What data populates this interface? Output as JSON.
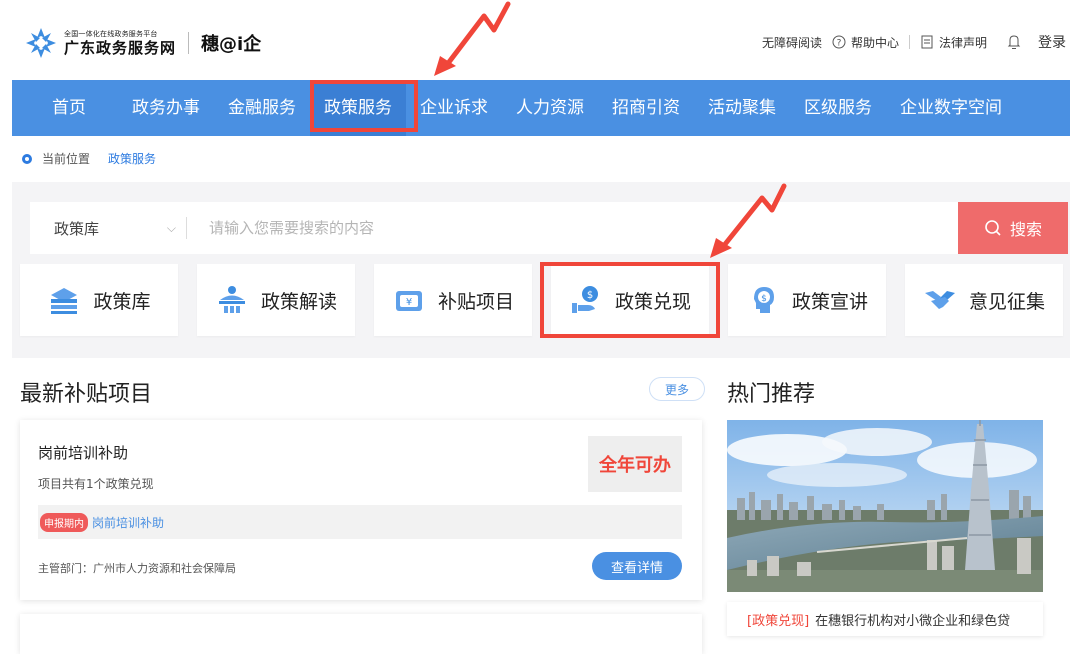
{
  "header": {
    "logo_sub": "全国一体化在线政务服务平台",
    "logo_main": "广东政务服务网",
    "brand": "穗@i企",
    "links": {
      "accessibility": "无障碍阅读",
      "help": "帮助中心",
      "legal": "法律声明",
      "login": "登录"
    },
    "icons": [
      "logo-icon",
      "help-icon",
      "document-icon",
      "bell-icon"
    ]
  },
  "nav": {
    "items": [
      "首页",
      "政务办事",
      "金融服务",
      "政策服务",
      "企业诉求",
      "人力资源",
      "招商引资",
      "活动聚集",
      "区级服务",
      "企业数字空间"
    ],
    "active_index": 3
  },
  "breadcrumb": {
    "label": "当前位置",
    "current": "政策服务"
  },
  "search": {
    "category": "政策库",
    "placeholder": "请输入您需要搜索的内容",
    "button": "搜索"
  },
  "quick_cards": [
    {
      "label": "政策库",
      "icon": "policy-library-icon"
    },
    {
      "label": "政策解读",
      "icon": "policy-interpretation-icon"
    },
    {
      "label": "补贴项目",
      "icon": "subsidy-icon"
    },
    {
      "label": "政策兑现",
      "icon": "policy-cashing-icon"
    },
    {
      "label": "政策宣讲",
      "icon": "policy-briefing-icon"
    },
    {
      "label": "意见征集",
      "icon": "feedback-icon"
    }
  ],
  "latest": {
    "title": "最新补贴项目",
    "more": "更多",
    "item": {
      "name": "岗前培训补助",
      "count_text": "项目共有1个政策兑现",
      "badge": "全年可办",
      "tag": "申报期内",
      "link": "岗前培训补助",
      "dept": "主管部门：广州市人力资源和社会保障局",
      "detail_button": "查看详情"
    }
  },
  "hot": {
    "title": "热门推荐",
    "caption_category": "[政策兑现]",
    "caption_text": "在穗银行机构对小微企业和绿色贷"
  },
  "colors": {
    "nav_blue": "#4a90e2",
    "highlight_red": "#f0463a",
    "search_btn": "#ef6b6b"
  }
}
